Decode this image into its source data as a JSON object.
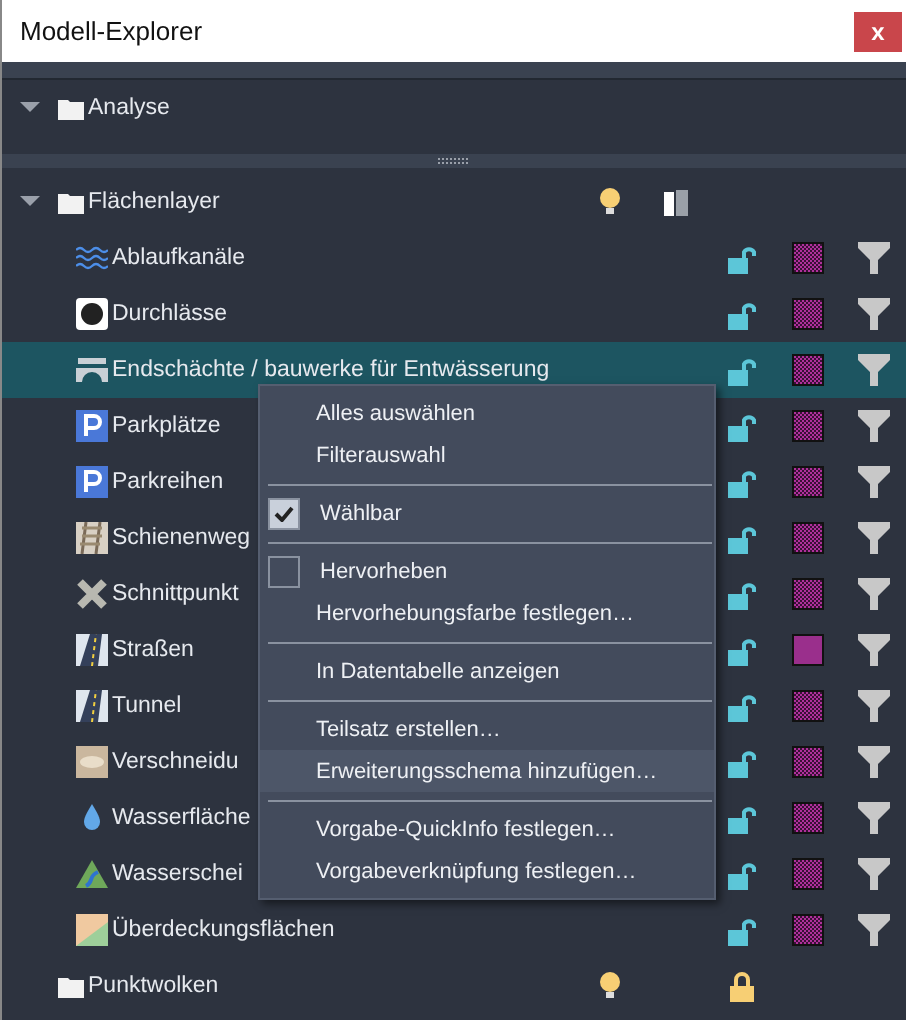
{
  "window": {
    "title": "Modell-Explorer",
    "close": "x"
  },
  "top_panel": {
    "groups": [
      {
        "label": "Analyse",
        "expanded": true
      }
    ]
  },
  "tree": {
    "groups": [
      {
        "label": "Flächenlayer",
        "expanded": true,
        "bulb": true,
        "split": true,
        "children": [
          {
            "label": "Ablaufkanäle",
            "kind": "waves",
            "selected": false,
            "locked": false,
            "patterned": true
          },
          {
            "label": "Durchlässe",
            "kind": "ring",
            "selected": false,
            "locked": false,
            "patterned": true
          },
          {
            "label": "Endschächte / bauwerke für Entwässerung",
            "kind": "bridge",
            "selected": true,
            "locked": false,
            "patterned": true
          },
          {
            "label": "Parkplätze",
            "kind": "parking",
            "selected": false,
            "locked": false,
            "patterned": true
          },
          {
            "label": "Parkreihen",
            "kind": "parking",
            "selected": false,
            "locked": false,
            "patterned": true
          },
          {
            "label": "Schienenweg",
            "kind": "rail",
            "selected": false,
            "locked": false,
            "patterned": true
          },
          {
            "label": "Schnittpunkt",
            "kind": "cross",
            "selected": false,
            "locked": false,
            "patterned": true
          },
          {
            "label": "Straßen",
            "kind": "road",
            "selected": false,
            "locked": false,
            "patterned": false
          },
          {
            "label": "Tunnel",
            "kind": "road",
            "selected": false,
            "locked": false,
            "patterned": true
          },
          {
            "label": "Verschneidu",
            "kind": "terrain",
            "selected": false,
            "locked": false,
            "patterned": true
          },
          {
            "label": "Wasserfläche",
            "kind": "drop",
            "selected": false,
            "locked": false,
            "patterned": true
          },
          {
            "label": "Wasserschei",
            "kind": "mountain",
            "selected": false,
            "locked": false,
            "patterned": true
          },
          {
            "label": "Überdeckungsflächen",
            "kind": "map",
            "selected": false,
            "locked": false,
            "patterned": true
          }
        ]
      },
      {
        "label": "Punktwolken",
        "expanded": false,
        "bulb": true,
        "split": false,
        "locked": true
      }
    ]
  },
  "context_menu": {
    "items": [
      {
        "kind": "action",
        "label": "Alles auswählen",
        "hovered": false
      },
      {
        "kind": "action",
        "label": "Filterauswahl",
        "hovered": false
      },
      {
        "kind": "separator"
      },
      {
        "kind": "check",
        "label": "Wählbar",
        "checked": true,
        "hovered": false
      },
      {
        "kind": "separator"
      },
      {
        "kind": "check",
        "label": "Hervorheben",
        "checked": false,
        "hovered": false
      },
      {
        "kind": "action",
        "label": "Hervorhebungsfarbe festlegen…",
        "hovered": false
      },
      {
        "kind": "separator"
      },
      {
        "kind": "action",
        "label": "In Datentabelle anzeigen",
        "hovered": false
      },
      {
        "kind": "separator"
      },
      {
        "kind": "action",
        "label": "Teilsatz erstellen…",
        "hovered": false
      },
      {
        "kind": "action",
        "label": "Erweiterungsschema hinzufügen…",
        "hovered": true
      },
      {
        "kind": "separator"
      },
      {
        "kind": "action",
        "label": "Vorgabe-QuickInfo festlegen…",
        "hovered": false
      },
      {
        "kind": "action",
        "label": "Vorgabeverknüpfung festlegen…",
        "hovered": false
      }
    ]
  }
}
